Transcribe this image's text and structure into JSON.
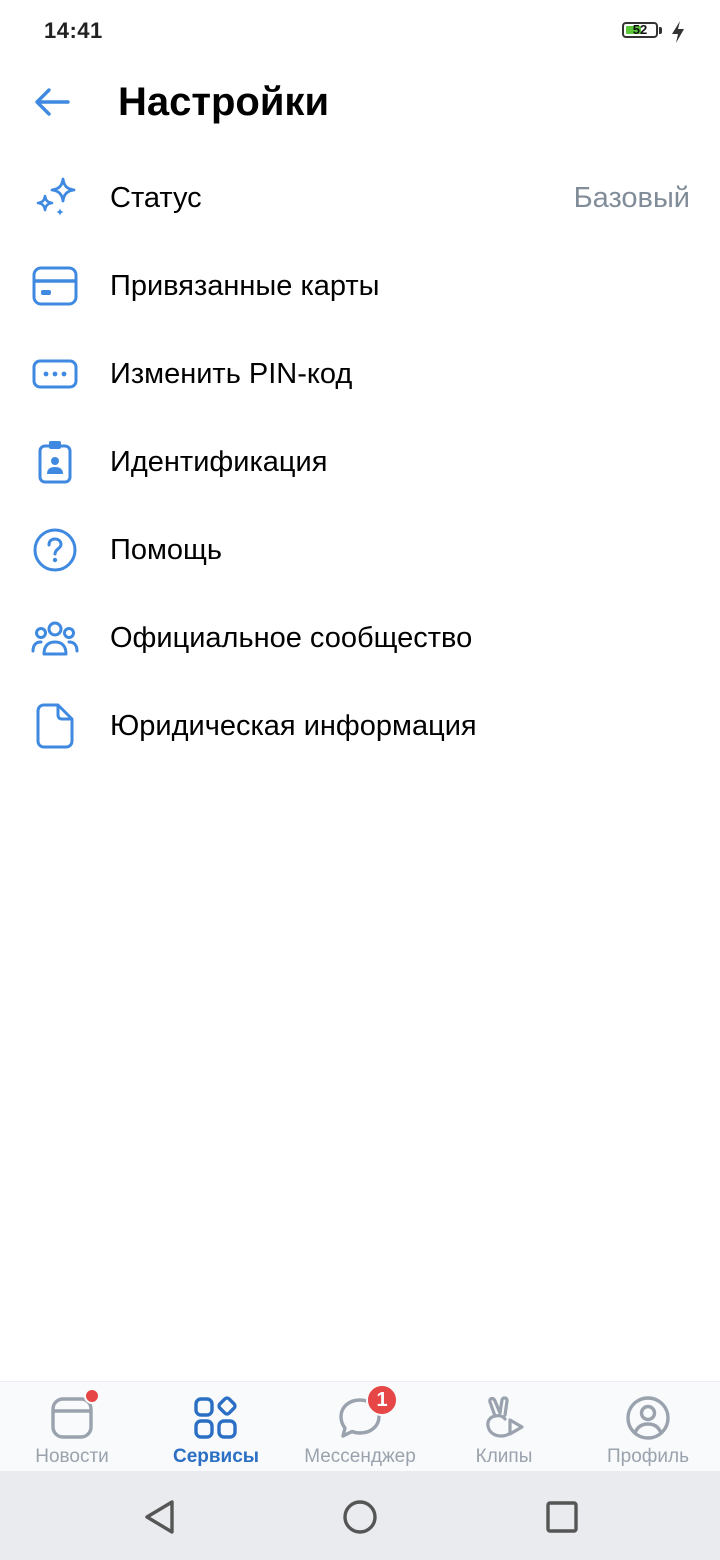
{
  "status_bar": {
    "time": "14:41",
    "battery_level": "52",
    "battery_fraction": 0.52,
    "charging_icon": "bolt-icon"
  },
  "header": {
    "back_icon": "arrow-left-icon",
    "title": "Настройки"
  },
  "settings": {
    "items": [
      {
        "icon": "sparkles-icon",
        "label": "Статус",
        "value": "Базовый"
      },
      {
        "icon": "credit-card-icon",
        "label": "Привязанные карты"
      },
      {
        "icon": "pin-code-icon",
        "label": "Изменить PIN-код"
      },
      {
        "icon": "id-badge-icon",
        "label": "Идентификация"
      },
      {
        "icon": "question-circle-icon",
        "label": "Помощь"
      },
      {
        "icon": "community-icon",
        "label": "Официальное сообщество"
      },
      {
        "icon": "document-icon",
        "label": "Юридическая информация"
      }
    ]
  },
  "tab_bar": {
    "tabs": [
      {
        "icon": "news-icon",
        "label": "Новости",
        "has_dot": true
      },
      {
        "icon": "services-icon",
        "label": "Сервисы",
        "active": true
      },
      {
        "icon": "messenger-icon",
        "label": "Мессенджер",
        "badge": "1"
      },
      {
        "icon": "clips-icon",
        "label": "Клипы"
      },
      {
        "icon": "profile-icon",
        "label": "Профиль"
      }
    ]
  },
  "system_nav": {
    "back_icon": "triangle-back-icon",
    "home_icon": "circle-home-icon",
    "recents_icon": "square-recents-icon"
  },
  "colors": {
    "accent": "#2b6fc4",
    "icon_blue": "#3f8ae0",
    "secondary_text": "#818c99",
    "inactive_tab": "#99a2ad",
    "badge_red": "#e64646",
    "battery_green": "#5ac83a"
  }
}
